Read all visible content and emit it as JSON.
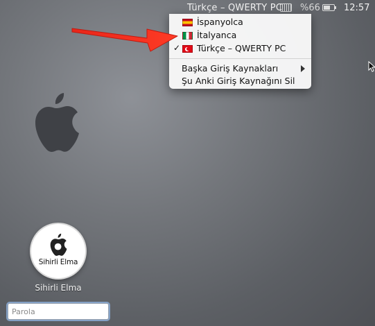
{
  "menubar": {
    "input_source": "Türkçe – QWERTY PC",
    "keyboard_icon": "keyboard-icon",
    "battery_percent": "%66",
    "battery_level": 0.66,
    "clock": "12:57"
  },
  "input_menu": {
    "items": [
      {
        "label": "İspanyolca",
        "flag": "spain-flag-icon",
        "checked": false
      },
      {
        "label": "İtalyanca",
        "flag": "italy-flag-icon",
        "checked": false
      },
      {
        "label": "Türkçe – QWERTY PC",
        "flag": "turkey-flag-icon",
        "checked": true,
        "check_mark": "✓"
      }
    ],
    "actions": [
      {
        "label": "Başka Giriş Kaynakları",
        "has_submenu": true
      },
      {
        "label": "Şu Anki Giriş Kaynağını Sil",
        "has_submenu": false
      }
    ]
  },
  "login": {
    "avatar_text": "Sihirli Elma",
    "username": "Sihirli Elma",
    "password_placeholder": "Parola"
  },
  "colors": {
    "annotation_arrow": "#f0301e",
    "menu_bg": "#f8f8f8"
  }
}
